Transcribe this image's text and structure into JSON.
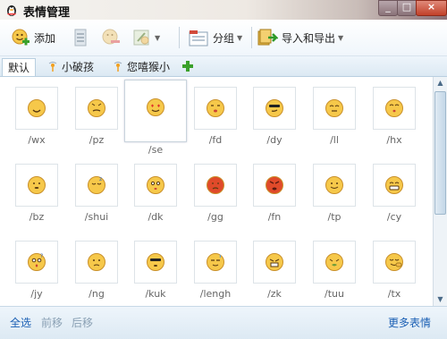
{
  "window": {
    "title": "表情管理",
    "minimize": "_",
    "maximize": "□",
    "close": "×"
  },
  "toolbar": {
    "add_label": "添加",
    "group_label": "分组",
    "import_export_label": "导入和导出"
  },
  "tabs": [
    {
      "label": "默认",
      "active": true
    },
    {
      "label": "小破孩",
      "active": false
    },
    {
      "label": "您嘻猴小",
      "active": false
    }
  ],
  "emoticons": [
    {
      "code": "/wx",
      "face": "smile"
    },
    {
      "code": "/pz",
      "face": "pz"
    },
    {
      "code": "/se",
      "face": "se"
    },
    {
      "code": "/fd",
      "face": "fd"
    },
    {
      "code": "/dy",
      "face": "dy"
    },
    {
      "code": "/ll",
      "face": "ll"
    },
    {
      "code": "/hx",
      "face": "hx"
    },
    {
      "code": "/bz",
      "face": "bz"
    },
    {
      "code": "/shui",
      "face": "shui"
    },
    {
      "code": "/dk",
      "face": "dk"
    },
    {
      "code": "/gg",
      "face": "gg"
    },
    {
      "code": "/fn",
      "face": "fn"
    },
    {
      "code": "/tp",
      "face": "tp"
    },
    {
      "code": "/cy",
      "face": "cy"
    },
    {
      "code": "/jy",
      "face": "jy"
    },
    {
      "code": "/ng",
      "face": "ng"
    },
    {
      "code": "/kuk",
      "face": "kuk"
    },
    {
      "code": "/lengh",
      "face": "lengh"
    },
    {
      "code": "/zk",
      "face": "zk"
    },
    {
      "code": "/tuu",
      "face": "tuu"
    },
    {
      "code": "/tx",
      "face": "tx"
    }
  ],
  "footer": {
    "select_all": "全选",
    "move_forward": "前移",
    "move_back": "后移",
    "more": "更多表情"
  },
  "colors": {
    "accent": "#1a5fb4",
    "face_yellow": "#f6c84a",
    "face_red": "#e04a2a"
  }
}
